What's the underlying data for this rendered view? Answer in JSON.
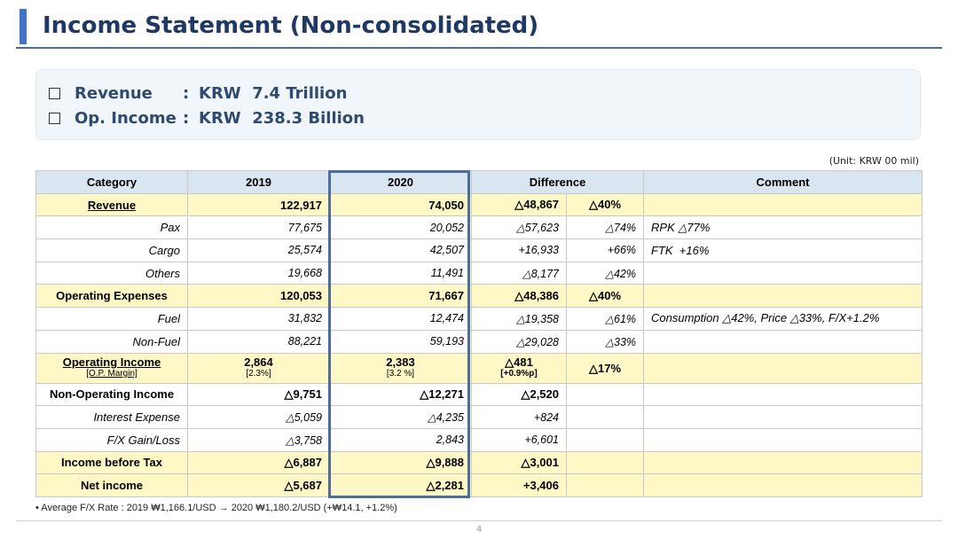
{
  "title": "Income Statement (Non-consolidated)",
  "summary": {
    "revenue_label": "Revenue",
    "revenue_value": "KRW  7.4 Trillion",
    "opincome_label": "Op. Income",
    "opincome_value": "KRW  238.3 Billion"
  },
  "unit": "(Unit: KRW 00 mil)",
  "table": {
    "headers": [
      "Category",
      "2019",
      "2020",
      "Difference",
      "Comment"
    ],
    "rows": {
      "revenue": {
        "category": "Revenue",
        "y2019": "122,917",
        "y2020": "74,050",
        "diff": "△48,867",
        "pct": "△40%",
        "comment": ""
      },
      "pax": {
        "category": "Pax",
        "y2019": "77,675",
        "y2020": "20,052",
        "diff": "△57,623",
        "pct": "△74%",
        "comment": "RPK △77%"
      },
      "cargo": {
        "category": "Cargo",
        "y2019": "25,574",
        "y2020": "42,507",
        "diff": "+16,933",
        "pct": "+66%",
        "comment": "FTK  +16%"
      },
      "others": {
        "category": "Others",
        "y2019": "19,668",
        "y2020": "11,491",
        "diff": "△8,177",
        "pct": "△42%",
        "comment": ""
      },
      "opex": {
        "category": "Operating Expenses",
        "y2019": "120,053",
        "y2020": "71,667",
        "diff": "△48,386",
        "pct": "△40%",
        "comment": ""
      },
      "fuel": {
        "category": "Fuel",
        "y2019": "31,832",
        "y2020": "12,474",
        "diff": "△19,358",
        "pct": "△61%",
        "comment": "Consumption △42%, Price △33%, F/X+1.2%"
      },
      "nonfuel": {
        "category": "Non-Fuel",
        "y2019": "88,221",
        "y2020": "59,193",
        "diff": "△29,028",
        "pct": "△33%",
        "comment": ""
      },
      "opincome": {
        "category": "Operating Income",
        "margin_label": "[O.P. Margin]",
        "y2019": "2,864",
        "y2019_margin": "[2.3%]",
        "y2020": "2,383",
        "y2020_margin": "[3.2 %]",
        "diff": "△481",
        "diff_margin": "[+0.9%p]",
        "pct": "△17%",
        "comment": ""
      },
      "nonop": {
        "category": "Non-Operating Income",
        "y2019": "△9,751",
        "y2020": "△12,271",
        "diff": "△2,520",
        "pct": "",
        "comment": ""
      },
      "interest": {
        "category": "Interest Expense",
        "y2019": "△5,059",
        "y2020": "△4,235",
        "diff": "+824",
        "pct": "",
        "comment": ""
      },
      "fx": {
        "category": "F/X Gain/Loss",
        "y2019": "△3,758",
        "y2020": "2,843",
        "diff": "+6,601",
        "pct": "",
        "comment": ""
      },
      "ibt": {
        "category": "Income before Tax",
        "y2019": "△6,887",
        "y2020": "△9,888",
        "diff": "△3,001",
        "pct": "",
        "comment": ""
      },
      "net": {
        "category": "Net income",
        "y2019": "△5,687",
        "y2020": "△2,281",
        "diff": "+3,406",
        "pct": "",
        "comment": ""
      }
    }
  },
  "footnote": "•   Average F/X Rate : 2019 ₩1,166.1/USD → 2020 ₩1,180.2/USD (+₩14.1, +1.2%)",
  "page_number": "4"
}
